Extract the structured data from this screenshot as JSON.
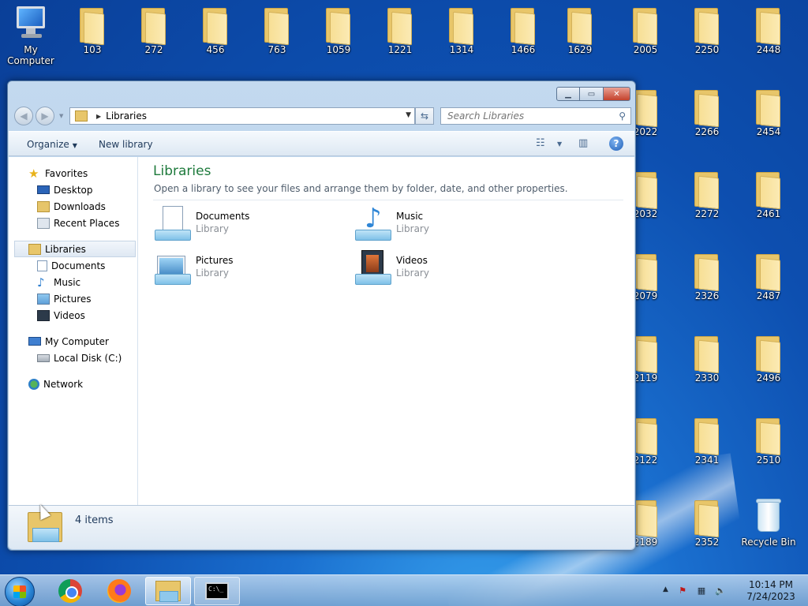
{
  "desktop": {
    "top_row": [
      {
        "label": "My Computer",
        "type": "computer"
      },
      {
        "label": "103",
        "type": "folder"
      },
      {
        "label": "272",
        "type": "folder"
      },
      {
        "label": "456",
        "type": "folder"
      },
      {
        "label": "763",
        "type": "folder"
      },
      {
        "label": "1059",
        "type": "folder"
      },
      {
        "label": "1221",
        "type": "folder"
      },
      {
        "label": "1314",
        "type": "folder"
      },
      {
        "label": "1466",
        "type": "folder"
      },
      {
        "label": "1629",
        "type": "folder"
      },
      {
        "label": "2005",
        "type": "folder"
      },
      {
        "label": "2250",
        "type": "folder"
      },
      {
        "label": "2448",
        "type": "folder"
      }
    ],
    "col_a": [
      "2022",
      "2032",
      "2079",
      "2119",
      "2122",
      "2189"
    ],
    "col_b": [
      "2266",
      "2272",
      "2326",
      "2330",
      "2341",
      "2352"
    ],
    "col_c": [
      "2454",
      "2461",
      "2487",
      "2496",
      "2510"
    ],
    "recycle_bin": "Recycle Bin"
  },
  "explorer": {
    "address": "Libraries",
    "search_placeholder": "Search Libraries",
    "toolbar": {
      "organize": "Organize",
      "new_library": "New library"
    },
    "nav": {
      "favorites": "Favorites",
      "desktop": "Desktop",
      "downloads": "Downloads",
      "recent_places": "Recent Places",
      "libraries": "Libraries",
      "documents": "Documents",
      "music": "Music",
      "pictures": "Pictures",
      "videos": "Videos",
      "my_computer": "My Computer",
      "local_disk": "Local Disk (C:)",
      "network": "Network"
    },
    "content": {
      "title": "Libraries",
      "subtitle": "Open a library to see your files and arrange them by folder, date, and other properties.",
      "items": [
        {
          "name": "Documents",
          "kind": "Library"
        },
        {
          "name": "Music",
          "kind": "Library"
        },
        {
          "name": "Pictures",
          "kind": "Library"
        },
        {
          "name": "Videos",
          "kind": "Library"
        }
      ]
    },
    "details": {
      "count": "4 items"
    }
  },
  "taskbar": {
    "cmd_glyph": "C:\\_",
    "clock": {
      "time": "10:14 PM",
      "date": "7/24/2023"
    }
  },
  "colors": {
    "title_green": "#1e7a3c",
    "wallpaper": "#0d4fb0",
    "folder": "#f7df95"
  }
}
